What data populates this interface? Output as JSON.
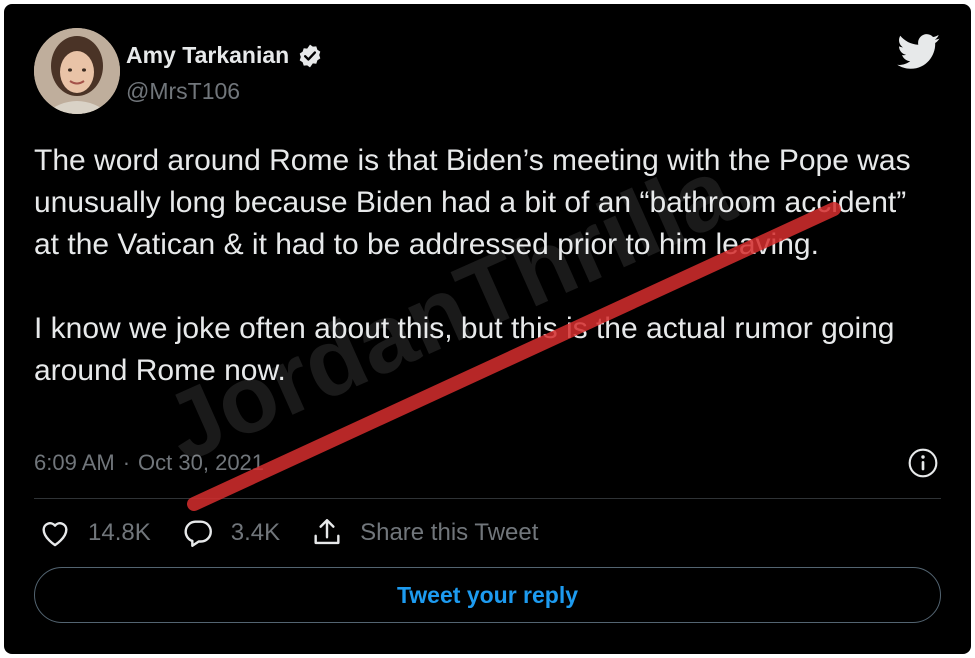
{
  "author": {
    "name": "Amy Tarkanian",
    "handle": "@MrsT106",
    "verified": true
  },
  "tweet": {
    "paragraphs": [
      "The word around Rome is that Biden’s meeting with the Pope was unusually long because Biden had a bit of an “bathroom accident” at the Vatican & it had to be addressed prior to him leaving.",
      "I know we joke often about this, but this is the actual rumor going around Rome now."
    ],
    "time": "6:09 AM",
    "separator": "·",
    "date": "Oct 30, 2021"
  },
  "actions": {
    "likes": "14.8K",
    "replies": "3.4K",
    "share_label": "Share this Tweet"
  },
  "reply_button": {
    "label": "Tweet your reply"
  },
  "watermark": {
    "text": "JordanThrilla."
  },
  "colors": {
    "background": "#000000",
    "text": "#e7e9ea",
    "muted": "#71767b",
    "accent": "#1d9bf0",
    "watermark": "#d62e2e"
  },
  "icons": {
    "logo": "twitter-bird-icon",
    "verified": "verified-badge-icon",
    "info": "info-icon",
    "like": "heart-icon",
    "reply": "comment-bubble-icon",
    "share": "share-upload-icon"
  }
}
